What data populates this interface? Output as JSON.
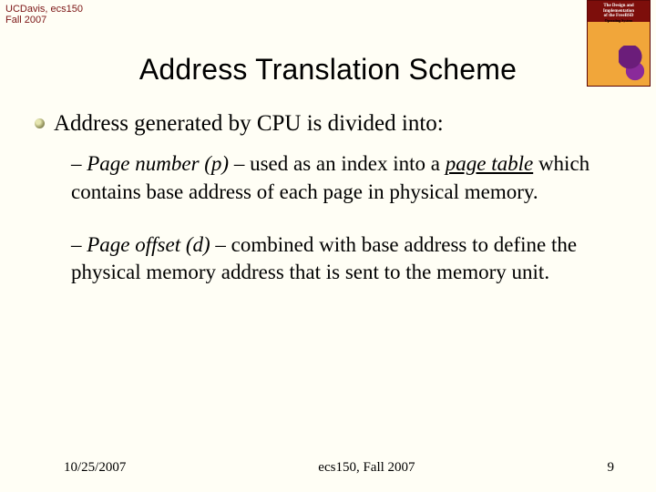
{
  "header": {
    "line1": "UCDavis, ecs150",
    "line2": "Fall 2007"
  },
  "book": {
    "top_line1": "The Design and",
    "top_line2": "Implementation",
    "top_line3": "of the FreeBSD",
    "sub": "Operating System"
  },
  "title": "Address Translation Scheme",
  "bullet1": "Address generated by CPU is divided into:",
  "sub1": {
    "dash": "– ",
    "lead": "Page number (p)",
    "mid1": " – used as an index into a ",
    "u": "page table",
    "mid2": " which contains base address of each page in physical memory."
  },
  "sub2": {
    "dash": "– ",
    "lead": "Page offset (d)",
    "mid1": " – combined with base address to define the physical memory address that is sent to the memory unit."
  },
  "footer": {
    "left": "10/25/2007",
    "center": "ecs150, Fall 2007",
    "right": "9"
  }
}
